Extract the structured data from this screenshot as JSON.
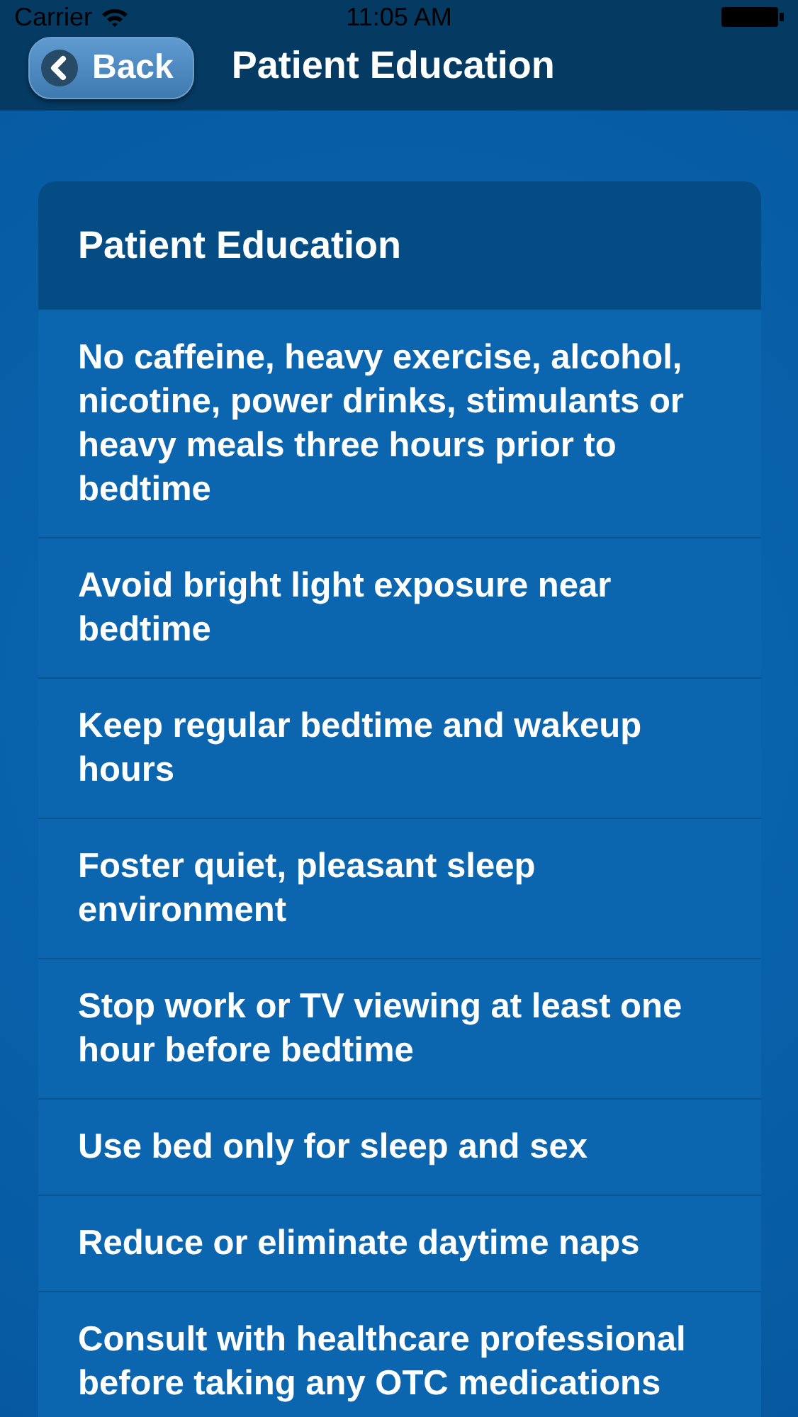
{
  "status_bar": {
    "carrier": "Carrier",
    "time": "11:05 AM"
  },
  "nav_bar": {
    "back_button": "Back",
    "title": "Patient Education"
  },
  "card": {
    "title": "Patient Education",
    "items": [
      "No caffeine, heavy exercise, alcohol, nicotine, power drinks, stimulants or heavy meals three hours prior to bedtime",
      "Avoid bright light exposure near bedtime",
      "Keep regular bedtime and wakeup hours",
      "Foster quiet, pleasant sleep environment",
      "Stop work or TV viewing at least one hour before bedtime",
      "Use bed only for sleep and sex",
      "Reduce or eliminate daytime naps",
      "Consult with healthcare professional before taking any OTC medications"
    ]
  }
}
